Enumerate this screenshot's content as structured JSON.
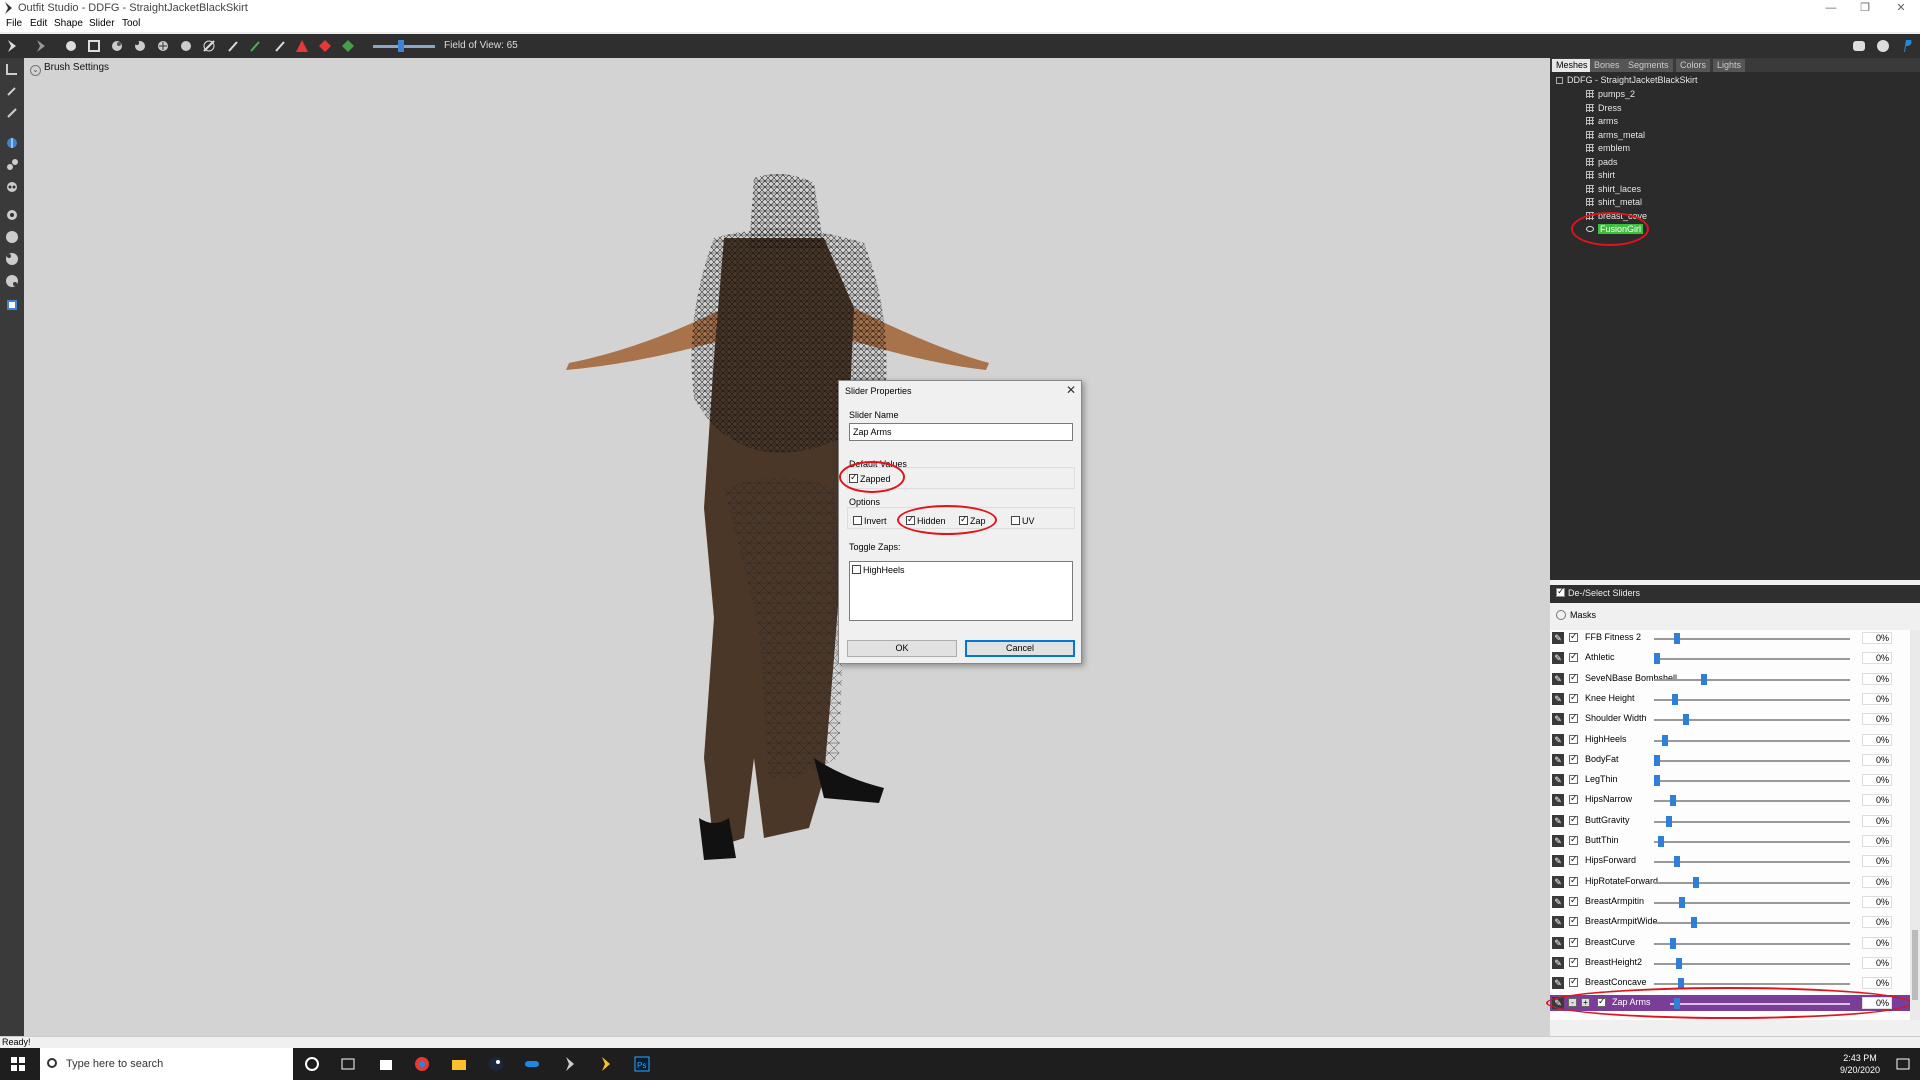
{
  "window": {
    "title": "Outfit Studio - DDFG - StraightJacketBlackSkirt"
  },
  "menu": [
    "File",
    "Edit",
    "Shape",
    "Slider",
    "Tool"
  ],
  "toolbar": {
    "fov_label": "Field of View: 65"
  },
  "viewport": {
    "brush_settings": "Brush Settings"
  },
  "right_tabs": [
    "Meshes",
    "Bones",
    "Segments",
    "Colors",
    "Lights"
  ],
  "mesh_tree": {
    "root": "DDFG - StraightJacketBlackSkirt",
    "items": [
      "pumps_2",
      "Dress",
      "arms",
      "arms_metal",
      "emblem",
      "pads",
      "shirt",
      "shirt_laces",
      "shirt_metal",
      "breast_cove",
      "FusionGirl"
    ],
    "selected": "FusionGirl"
  },
  "sliders_panel": {
    "header": "De-/Select Sliders",
    "masks": "Masks",
    "sliders": [
      {
        "name": "FFB Fitness 2",
        "value": "0%",
        "pos": 0.1
      },
      {
        "name": "Athletic",
        "value": "0%",
        "pos": 0.0
      },
      {
        "name": "SeveNBase Bombshell",
        "value": "0%",
        "pos": 0.24
      },
      {
        "name": "Knee Height",
        "value": "0%",
        "pos": 0.09
      },
      {
        "name": "Shoulder Width",
        "value": "0%",
        "pos": 0.15
      },
      {
        "name": "HighHeels",
        "value": "0%",
        "pos": 0.04
      },
      {
        "name": "BodyFat",
        "value": "0%",
        "pos": 0.0
      },
      {
        "name": "LegThin",
        "value": "0%",
        "pos": 0.0
      },
      {
        "name": "HipsNarrow",
        "value": "0%",
        "pos": 0.08
      },
      {
        "name": "ButtGravity",
        "value": "0%",
        "pos": 0.06
      },
      {
        "name": "ButtThin",
        "value": "0%",
        "pos": 0.02
      },
      {
        "name": "HipsForward",
        "value": "0%",
        "pos": 0.1
      },
      {
        "name": "HipRotateForward",
        "value": "0%",
        "pos": 0.2
      },
      {
        "name": "BreastArmpitin",
        "value": "0%",
        "pos": 0.13
      },
      {
        "name": "BreastArmpitWide",
        "value": "0%",
        "pos": 0.19
      },
      {
        "name": "BreastCurve",
        "value": "0%",
        "pos": 0.08
      },
      {
        "name": "BreastHeight2",
        "value": "0%",
        "pos": 0.11
      },
      {
        "name": "BreastConcave",
        "value": "0%",
        "pos": 0.12
      }
    ],
    "zap_slider": {
      "name": "Zap Arms",
      "value": "0%",
      "pos": 0.02
    }
  },
  "dialog": {
    "title": "Slider Properties",
    "slider_name_label": "Slider Name",
    "slider_name_value": "Zap Arms",
    "default_values_label": "Default Values",
    "zapped_label": "Zapped",
    "options_label": "Options",
    "invert_label": "Invert",
    "hidden_label": "Hidden",
    "zap_label": "Zap",
    "uv_label": "UV",
    "toggle_zaps_label": "Toggle Zaps:",
    "toggle_zap_item": "HighHeels",
    "ok_label": "OK",
    "cancel_label": "Cancel"
  },
  "statusbar": {
    "text": "Ready!"
  },
  "taskbar": {
    "search_placeholder": "Type here to search",
    "time": "2:43 PM",
    "date": "9/20/2020"
  },
  "colors": {
    "zap_row": "#7a3d98",
    "selected_mesh": "#3dbf3d",
    "annotation": "#e0141b"
  }
}
